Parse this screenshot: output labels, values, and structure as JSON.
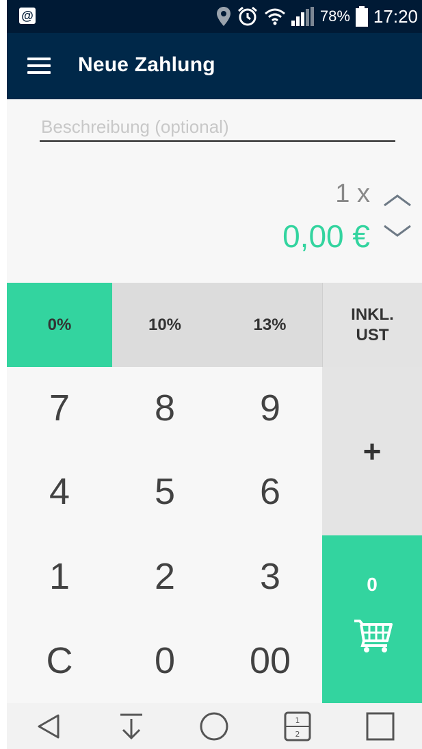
{
  "status_bar": {
    "notification_icon": "@",
    "battery": "78%",
    "time": "17:20",
    "icons": [
      "location-icon",
      "alarm-icon",
      "wifi-icon",
      "signal-icon",
      "battery-icon"
    ]
  },
  "app_bar": {
    "title": "Neue Zahlung",
    "menu_icon": "hamburger-menu-icon"
  },
  "description": {
    "placeholder": "Beschreibung (optional)",
    "value": ""
  },
  "amount": {
    "quantity": "1 x",
    "value": "0,00 €"
  },
  "tax_options": [
    {
      "label": "0%",
      "selected": true
    },
    {
      "label": "10%",
      "selected": false
    },
    {
      "label": "13%",
      "selected": false
    }
  ],
  "tax_mode": "INKL.\nUST",
  "keypad": {
    "keys": [
      "7",
      "8",
      "9",
      "4",
      "5",
      "6",
      "1",
      "2",
      "3",
      "C",
      "0",
      "00"
    ],
    "plus": "+",
    "cart_count": "0"
  },
  "colors": {
    "accent": "#33d49f",
    "header": "#002849",
    "statusbar": "#001a35"
  }
}
